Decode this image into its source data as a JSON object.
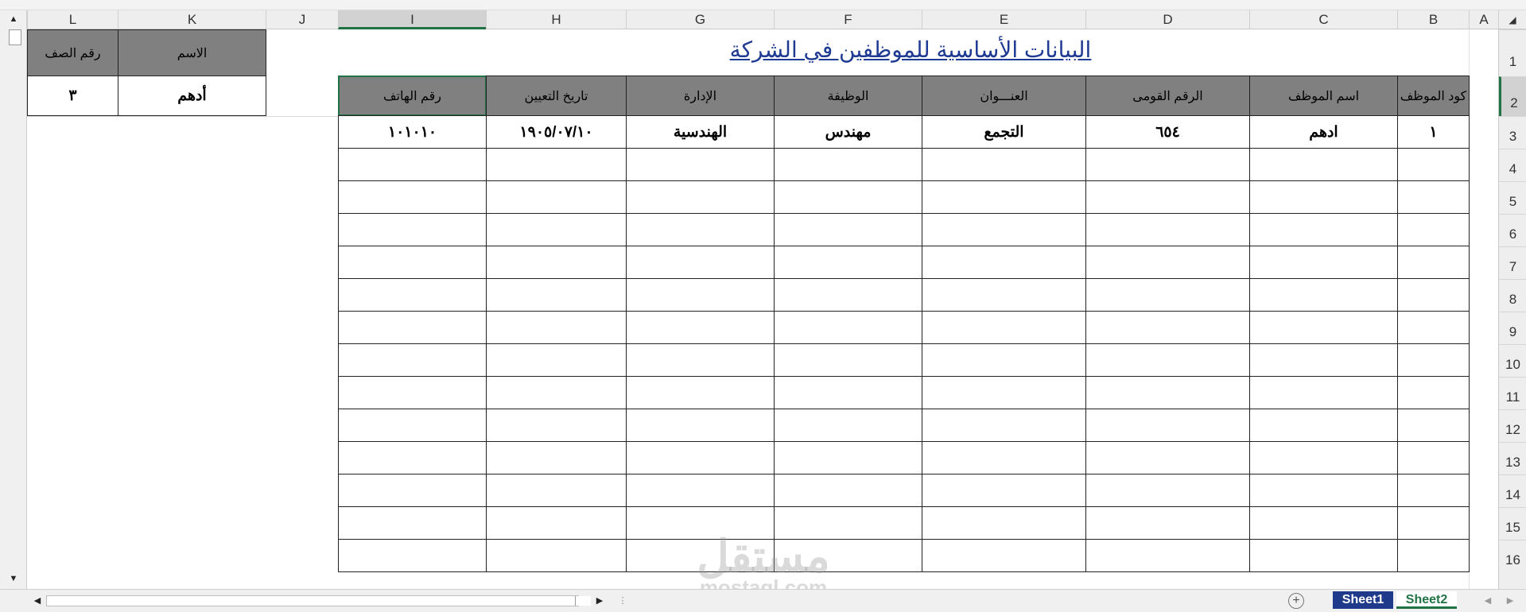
{
  "columns": [
    "L",
    "K",
    "J",
    "I",
    "H",
    "G",
    "F",
    "E",
    "D",
    "C",
    "B",
    "A"
  ],
  "rows": [
    "1",
    "2",
    "3",
    "4",
    "5",
    "6",
    "7",
    "8",
    "9",
    "10",
    "11",
    "12",
    "13",
    "14",
    "15",
    "16"
  ],
  "sheet_title": "البيانات الأساسية للموظفين في الشركة",
  "lookup": {
    "headers": [
      "رقم الصف",
      "الاسم"
    ],
    "values": [
      "٣",
      "أدهم"
    ]
  },
  "table": {
    "headers": [
      "رقم الهاتف",
      "تاريخ التعيين",
      "الإدارة",
      "الوظيفة",
      "العنـــوان",
      "الرقم القومى",
      "اسم الموظف",
      "كود الموظف"
    ],
    "first_row": [
      "١٠١٠١٠",
      "١٩٠٥/٠٧/١٠",
      "الهندسية",
      "مهندس",
      "التجمع",
      "٦٥٤",
      "ادهم",
      "١"
    ]
  },
  "sheets": [
    "Sheet1",
    "Sheet2"
  ],
  "active_sheet": "Sheet2",
  "watermark": {
    "arabic": "مستقل",
    "latin": "mostaql.com"
  },
  "colors": {
    "header_fill": "#808080",
    "title": "#1f3a93",
    "accent": "#217346",
    "sheet1_tab": "#1f3a8a"
  }
}
